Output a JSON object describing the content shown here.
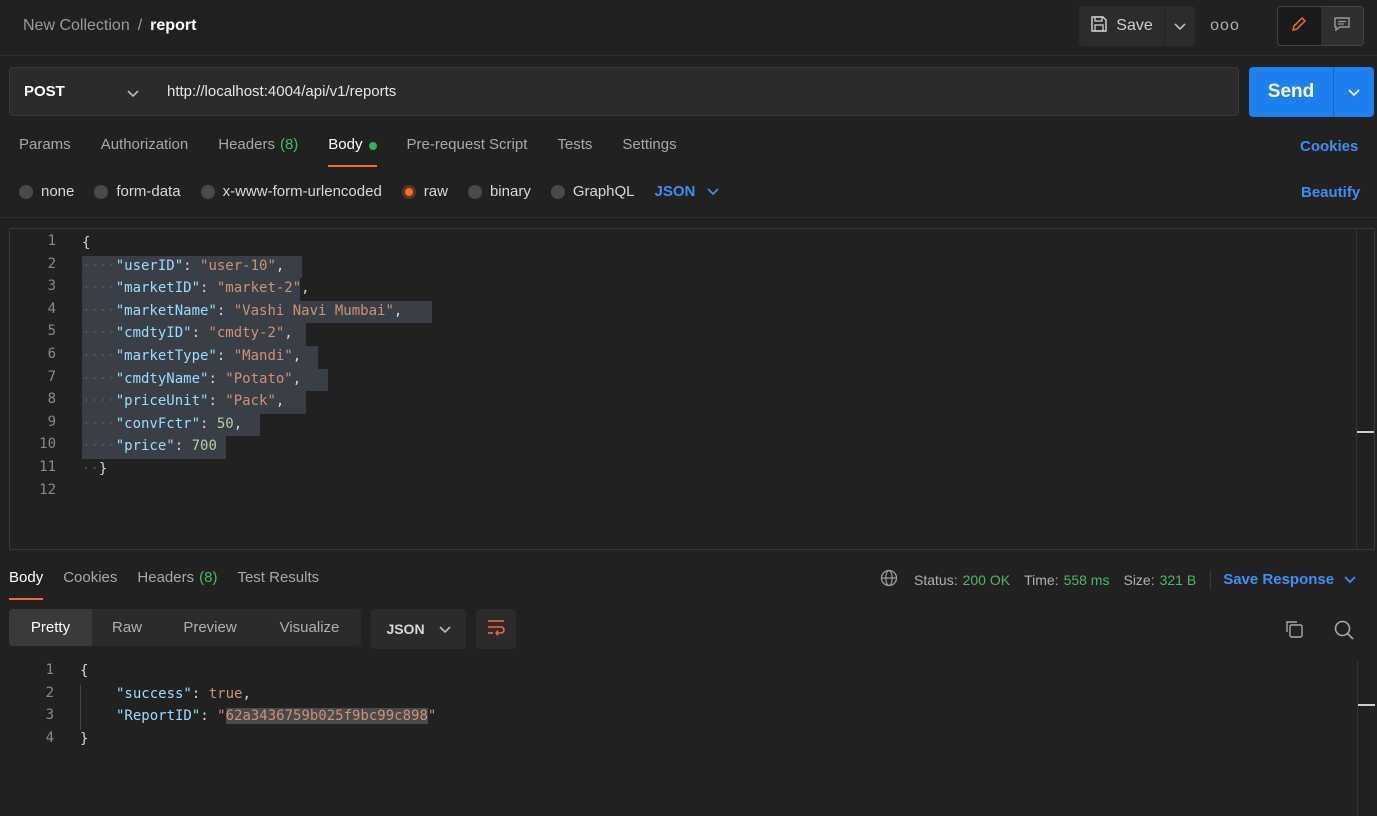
{
  "breadcrumb": {
    "parent": "New Collection",
    "separator": "/",
    "current": "report"
  },
  "toolbar": {
    "save_label": "Save",
    "more_label": "ooo"
  },
  "request": {
    "method": "POST",
    "url": "http://localhost:4004/api/v1/reports",
    "send_label": "Send"
  },
  "request_tabs": {
    "params": "Params",
    "authorization": "Authorization",
    "headers": "Headers",
    "headers_count": "(8)",
    "body": "Body",
    "prerequest": "Pre-request Script",
    "tests": "Tests",
    "settings": "Settings",
    "cookies": "Cookies"
  },
  "body_types": {
    "none": "none",
    "form_data": "form-data",
    "urlencoded": "x-www-form-urlencoded",
    "raw": "raw",
    "binary": "binary",
    "graphql": "GraphQL",
    "language": "JSON",
    "beautify": "Beautify"
  },
  "request_body": {
    "line_numbers": [
      "1",
      "2",
      "3",
      "4",
      "5",
      "6",
      "7",
      "8",
      "9",
      "10",
      "11",
      "12"
    ],
    "open_brace": "{",
    "close_brace": "}",
    "fields": [
      {
        "key": "\"userID\"",
        "value": "\"user-10\"",
        "type": "string",
        "comma": ","
      },
      {
        "key": "\"marketID\"",
        "value": "\"market-2\"",
        "type": "string",
        "comma": ","
      },
      {
        "key": "\"marketName\"",
        "value": "\"Vashi Navi Mumbai\"",
        "type": "string",
        "comma": ","
      },
      {
        "key": "\"cmdtyID\"",
        "value": "\"cmdty-2\"",
        "type": "string",
        "comma": ","
      },
      {
        "key": "\"marketType\"",
        "value": "\"Mandi\"",
        "type": "string",
        "comma": ","
      },
      {
        "key": "\"cmdtyName\"",
        "value": "\"Potato\"",
        "type": "string",
        "comma": ","
      },
      {
        "key": "\"priceUnit\"",
        "value": "\"Pack\"",
        "type": "string",
        "comma": ","
      },
      {
        "key": "\"convFctr\"",
        "value": "50",
        "type": "number",
        "comma": ","
      },
      {
        "key": "\"price\"",
        "value": "700",
        "type": "number",
        "comma": ""
      }
    ]
  },
  "response_tabs": {
    "body": "Body",
    "cookies": "Cookies",
    "headers": "Headers",
    "headers_count": "(8)",
    "test_results": "Test Results"
  },
  "response_status": {
    "status_label": "Status:",
    "status_value": "200 OK",
    "time_label": "Time:",
    "time_value": "558 ms",
    "size_label": "Size:",
    "size_value": "321 B",
    "save_response": "Save Response"
  },
  "response_view": {
    "pretty": "Pretty",
    "raw": "Raw",
    "preview": "Preview",
    "visualize": "Visualize",
    "language": "JSON"
  },
  "response_body": {
    "line_numbers": [
      "1",
      "2",
      "3",
      "4"
    ],
    "open_brace": "{",
    "close_brace": "}",
    "success_key": "\"success\"",
    "success_value": "true",
    "report_key": "\"ReportID\"",
    "report_value": "62a3436759b025f9bc99c898"
  },
  "colors": {
    "accent_blue": "#1e80ee",
    "active_tab": "#f26b3a",
    "status_green": "#49b86a"
  }
}
